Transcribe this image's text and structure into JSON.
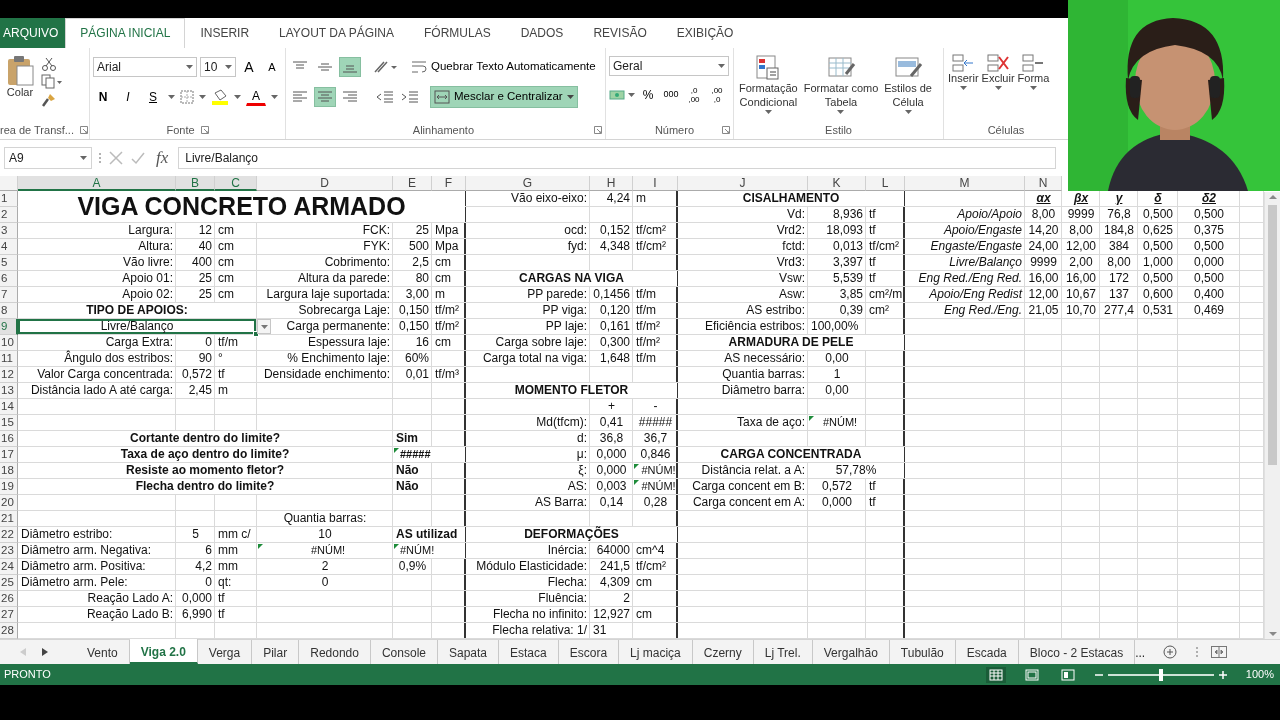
{
  "ribbon_tabs": [
    {
      "label": "ARQUIVO",
      "kind": "file",
      "selected": false
    },
    {
      "label": "PÁGINA INICIAL",
      "kind": "tab",
      "selected": true
    },
    {
      "label": "INSERIR",
      "kind": "tab",
      "selected": false
    },
    {
      "label": "LAYOUT DA PÁGINA",
      "kind": "tab",
      "selected": false
    },
    {
      "label": "FÓRMULAS",
      "kind": "tab",
      "selected": false
    },
    {
      "label": "DADOS",
      "kind": "tab",
      "selected": false
    },
    {
      "label": "REVISÃO",
      "kind": "tab",
      "selected": false
    },
    {
      "label": "EXIBIÇÃO",
      "kind": "tab",
      "selected": false
    }
  ],
  "clipboard": {
    "paste": "Colar",
    "label": "rea de Transf..."
  },
  "font": {
    "name": "Arial",
    "size": "10",
    "grow": "A",
    "shrink": "A",
    "bold": "N",
    "italic": "I",
    "underline": "S",
    "color_letter": "A",
    "label": "Fonte"
  },
  "alignment": {
    "vertical": [
      {
        "kind": "top",
        "selected": false
      },
      {
        "kind": "middle",
        "selected": false
      },
      {
        "kind": "bottom",
        "selected": true
      }
    ],
    "horizontal": [
      {
        "kind": "left",
        "selected": false
      },
      {
        "kind": "center",
        "selected": true
      },
      {
        "kind": "right",
        "selected": false
      }
    ],
    "wrap": "Quebrar Texto Automaticamente",
    "merge": {
      "label": "Mesclar e Centralizar",
      "selected": true
    },
    "label": "Alinhamento"
  },
  "number": {
    "format": "Geral",
    "percent": "%",
    "thousands": "000",
    "decimals": [
      {
        "top": ",0",
        "bottom": ",00"
      },
      {
        "top": ",00",
        "bottom": ",0"
      }
    ],
    "label": "Número"
  },
  "styles": {
    "buttons": [
      {
        "lines": [
          "Formatação",
          "Condicional"
        ],
        "kind": "conditional"
      },
      {
        "lines": [
          "Formatar como",
          "Tabela"
        ],
        "kind": "table"
      },
      {
        "lines": [
          "Estilos de",
          "Célula"
        ],
        "kind": "cellstyle"
      }
    ],
    "label": "Estilo"
  },
  "cells_group": {
    "buttons": [
      {
        "label": "Inserir",
        "kind": "insert"
      },
      {
        "label": "Excluir",
        "kind": "delete"
      },
      {
        "label": "Forma",
        "kind": "format"
      }
    ],
    "label": "Células"
  },
  "formula_bar": {
    "name_box": "A9",
    "fx": "fx",
    "content": "Livre/Balanço"
  },
  "columns": [
    {
      "label": "A",
      "selected": true
    },
    {
      "label": "B",
      "selected": true
    },
    {
      "label": "C",
      "selected": true
    },
    {
      "label": "D",
      "selected": false
    },
    {
      "label": "E",
      "selected": false
    },
    {
      "label": "F",
      "selected": false
    },
    {
      "label": "G",
      "selected": false
    },
    {
      "label": "H",
      "selected": false
    },
    {
      "label": "I",
      "selected": false
    },
    {
      "label": "J",
      "selected": false
    },
    {
      "label": "K",
      "selected": false
    },
    {
      "label": "L",
      "selected": false
    },
    {
      "label": "M",
      "selected": false
    },
    {
      "label": "N",
      "selected": false
    }
  ],
  "rows": [
    {
      "number": "1",
      "selected": false,
      "cells": [
        {
          "text": "VIGA CONCRETO ARMADO"
        },
        {
          "text": "Vão eixo-eixo:"
        },
        {
          "text": "4,24"
        },
        {
          "text": "m"
        },
        {
          "text": "CISALHAMENTO"
        },
        {
          "text": "αx"
        },
        {
          "text": "βx"
        },
        {
          "text": "γ"
        },
        {
          "text": "δ"
        },
        {
          "text": "δ2"
        }
      ]
    },
    {
      "number": "2",
      "selected": false,
      "cells": [
        {
          "text": "Vd:"
        },
        {
          "text": "8,936"
        },
        {
          "text": "tf"
        },
        {
          "text": "Apoio/Apoio"
        },
        {
          "text": "8,00"
        },
        {
          "text": "9999"
        },
        {
          "text": "76,8"
        },
        {
          "text": "0,500"
        },
        {
          "text": "0,500"
        }
      ]
    },
    {
      "number": "3",
      "selected": false,
      "cells": [
        {
          "text": "Largura:"
        },
        {
          "text": "12"
        },
        {
          "text": "cm"
        },
        {
          "text": "FCK:"
        },
        {
          "text": "25"
        },
        {
          "text": "Mpa"
        },
        {
          "text": "ocd:"
        },
        {
          "text": "0,152"
        },
        {
          "text": "tf/cm²"
        },
        {
          "text": "Vrd2:"
        },
        {
          "text": "18,093"
        },
        {
          "text": "tf"
        },
        {
          "text": "Apoio/Engaste"
        },
        {
          "text": "14,20"
        },
        {
          "text": "8,00"
        },
        {
          "text": "184,8"
        },
        {
          "text": "0,625"
        },
        {
          "text": "0,375"
        }
      ]
    },
    {
      "number": "4",
      "selected": false,
      "cells": [
        {
          "text": "Altura:"
        },
        {
          "text": "40"
        },
        {
          "text": "cm"
        },
        {
          "text": "FYK:"
        },
        {
          "text": "500"
        },
        {
          "text": "Mpa"
        },
        {
          "text": "fyd:"
        },
        {
          "text": "4,348"
        },
        {
          "text": "tf/cm²"
        },
        {
          "text": "fctd:"
        },
        {
          "text": "0,013"
        },
        {
          "text": "tf/cm²"
        },
        {
          "text": "Engaste/Engaste"
        },
        {
          "text": "24,00"
        },
        {
          "text": "12,00"
        },
        {
          "text": "384"
        },
        {
          "text": "0,500"
        },
        {
          "text": "0,500"
        }
      ]
    },
    {
      "number": "5",
      "selected": false,
      "cells": [
        {
          "text": "Vão livre:"
        },
        {
          "text": "400"
        },
        {
          "text": "cm"
        },
        {
          "text": "Cobrimento:"
        },
        {
          "text": "2,5"
        },
        {
          "text": "cm"
        },
        {
          "text": "Vrd3:"
        },
        {
          "text": "3,397"
        },
        {
          "text": "tf"
        },
        {
          "text": "Livre/Balanço"
        },
        {
          "text": "9999"
        },
        {
          "text": "2,00"
        },
        {
          "text": "8,00"
        },
        {
          "text": "1,000"
        },
        {
          "text": "0,000"
        }
      ]
    },
    {
      "number": "6",
      "selected": false,
      "cells": [
        {
          "text": "Apoio 01:"
        },
        {
          "text": "25"
        },
        {
          "text": "cm"
        },
        {
          "text": "Altura da parede:"
        },
        {
          "text": "80"
        },
        {
          "text": "cm"
        },
        {
          "text": "CARGAS NA VIGA"
        },
        {
          "text": "Vsw:"
        },
        {
          "text": "5,539"
        },
        {
          "text": "tf"
        },
        {
          "text": "Eng Red./Eng Red."
        },
        {
          "text": "16,00"
        },
        {
          "text": "16,00"
        },
        {
          "text": "172"
        },
        {
          "text": "0,500"
        },
        {
          "text": "0,500"
        }
      ]
    },
    {
      "number": "7",
      "selected": false,
      "cells": [
        {
          "text": "Apoio 02:"
        },
        {
          "text": "25"
        },
        {
          "text": "cm"
        },
        {
          "text": "Largura laje suportada:"
        },
        {
          "text": "3,00"
        },
        {
          "text": "m"
        },
        {
          "text": "PP parede:"
        },
        {
          "text": "0,1456"
        },
        {
          "text": "tf/m"
        },
        {
          "text": "Asw:"
        },
        {
          "text": "3,85"
        },
        {
          "text": "cm²/m"
        },
        {
          "text": "Apoio/Eng Redist"
        },
        {
          "text": "12,00"
        },
        {
          "text": "10,67"
        },
        {
          "text": "137"
        },
        {
          "text": "0,600"
        },
        {
          "text": "0,400"
        }
      ]
    },
    {
      "number": "8",
      "selected": false,
      "cells": [
        {
          "text": "TIPO DE APOIOS:"
        },
        {
          "text": "Sobrecarga Laje:"
        },
        {
          "text": "0,150"
        },
        {
          "text": "tf/m²"
        },
        {
          "text": "PP viga:"
        },
        {
          "text": "0,120"
        },
        {
          "text": "tf/m"
        },
        {
          "text": "AS estribo:"
        },
        {
          "text": "0,39"
        },
        {
          "text": "cm²"
        },
        {
          "text": "Eng Red./Eng."
        },
        {
          "text": "21,05"
        },
        {
          "text": "10,70"
        },
        {
          "text": "277,4"
        },
        {
          "text": "0,531"
        },
        {
          "text": "0,469"
        }
      ]
    },
    {
      "number": "9",
      "selected": true,
      "cells": [
        {
          "text": "Livre/Balanço",
          "selected": true
        },
        {
          "text": "Carga permanente:"
        },
        {
          "text": "0,150"
        },
        {
          "text": "tf/m²"
        },
        {
          "text": "PP laje:"
        },
        {
          "text": "0,161"
        },
        {
          "text": "tf/m²"
        },
        {
          "text": "Eficiência estribos:"
        },
        {
          "text": "100,00%"
        }
      ]
    },
    {
      "number": "10",
      "selected": false,
      "cells": [
        {
          "text": "Carga Extra:"
        },
        {
          "text": "0"
        },
        {
          "text": "tf/m"
        },
        {
          "text": "Espessura laje:"
        },
        {
          "text": "16"
        },
        {
          "text": "cm"
        },
        {
          "text": "Carga sobre laje:"
        },
        {
          "text": "0,300"
        },
        {
          "text": "tf/m²"
        },
        {
          "text": "ARMADURA DE PELE"
        }
      ]
    },
    {
      "number": "11",
      "selected": false,
      "cells": [
        {
          "text": "Ângulo dos estribos:"
        },
        {
          "text": "90"
        },
        {
          "text": "°"
        },
        {
          "text": "% Enchimento laje:"
        },
        {
          "text": "60%"
        },
        {
          "text": "Carga total na viga:"
        },
        {
          "text": "1,648"
        },
        {
          "text": "tf/m"
        },
        {
          "text": "AS necessário:"
        },
        {
          "text": "0,00"
        }
      ]
    },
    {
      "number": "12",
      "selected": false,
      "cells": [
        {
          "text": "Valor Carga concentrada:"
        },
        {
          "text": "0,572"
        },
        {
          "text": "tf"
        },
        {
          "text": "Densidade enchimento:"
        },
        {
          "text": "0,01"
        },
        {
          "text": "tf/m³"
        },
        {
          "text": "Quantia barras:"
        },
        {
          "text": "1"
        }
      ]
    },
    {
      "number": "13",
      "selected": false,
      "cells": [
        {
          "text": "Distância lado A até carga:"
        },
        {
          "text": "2,45"
        },
        {
          "text": "m"
        },
        {
          "text": "MOMENTO FLETOR"
        },
        {
          "text": "Diâmetro barra:"
        },
        {
          "text": "0,00"
        }
      ]
    },
    {
      "number": "14",
      "selected": false,
      "cells": [
        {
          "text": "+"
        },
        {
          "text": "-"
        }
      ]
    },
    {
      "number": "15",
      "selected": false,
      "cells": [
        {
          "text": "Md(tfcm):"
        },
        {
          "text": "0,41"
        },
        {
          "text": "#####"
        },
        {
          "text": "Taxa de aço:"
        },
        {
          "text": "#NÚM!",
          "warning": true
        }
      ]
    },
    {
      "number": "16",
      "selected": false,
      "cells": [
        {
          "text": "Cortante dentro do limite?"
        },
        {
          "text": "Sim"
        },
        {
          "text": "d:"
        },
        {
          "text": "36,8"
        },
        {
          "text": "36,7"
        }
      ]
    },
    {
      "number": "17",
      "selected": false,
      "cells": [
        {
          "text": "Taxa de aço dentro do limite?"
        },
        {
          "text": "#####",
          "warning": true
        },
        {
          "text": "μ:"
        },
        {
          "text": "0,000"
        },
        {
          "text": "0,846"
        },
        {
          "text": "CARGA CONCENTRADA"
        }
      ]
    },
    {
      "number": "18",
      "selected": false,
      "cells": [
        {
          "text": "Resiste ao momento fletor?"
        },
        {
          "text": "Não"
        },
        {
          "text": "ξ:"
        },
        {
          "text": "0,000"
        },
        {
          "text": "#NÚM!",
          "warning": true
        },
        {
          "text": "Distância relat. a A:"
        },
        {
          "text": "57,78%"
        }
      ]
    },
    {
      "number": "19",
      "selected": false,
      "cells": [
        {
          "text": "Flecha dentro do limite?"
        },
        {
          "text": "Não"
        },
        {
          "text": "AS:"
        },
        {
          "text": "0,003"
        },
        {
          "text": "#NÚM!",
          "warning": true
        },
        {
          "text": "Carga concent em B:"
        },
        {
          "text": "0,572"
        },
        {
          "text": "tf"
        }
      ]
    },
    {
      "number": "20",
      "selected": false,
      "cells": [
        {
          "text": "AS Barra:"
        },
        {
          "text": "0,14"
        },
        {
          "text": "0,28"
        },
        {
          "text": "Carga concent em A:"
        },
        {
          "text": "0,000"
        },
        {
          "text": "tf"
        }
      ]
    },
    {
      "number": "21",
      "selected": false,
      "cells": [
        {
          "text": "Quantia barras:"
        }
      ]
    },
    {
      "number": "22",
      "selected": false,
      "cells": [
        {
          "text": "Diâmetro estribo:"
        },
        {
          "text": "5"
        },
        {
          "text": "mm c/"
        },
        {
          "text": "10"
        },
        {
          "text": "AS utilizad"
        },
        {
          "text": "DEFORMAÇÕES"
        }
      ]
    },
    {
      "number": "23",
      "selected": false,
      "cells": [
        {
          "text": "Diâmetro arm. Negativa:"
        },
        {
          "text": "6"
        },
        {
          "text": "mm"
        },
        {
          "text": "#NÚM!",
          "warning": true
        },
        {
          "text": "#NÚM!",
          "warning": true
        },
        {
          "text": "Inércia:"
        },
        {
          "text": "64000"
        },
        {
          "text": "cm^4"
        }
      ]
    },
    {
      "number": "24",
      "selected": false,
      "cells": [
        {
          "text": "Diâmetro arm. Positiva:"
        },
        {
          "text": "4,2"
        },
        {
          "text": "mm"
        },
        {
          "text": "2"
        },
        {
          "text": "0,9%"
        },
        {
          "text": "Módulo Elasticidade:"
        },
        {
          "text": "241,5"
        },
        {
          "text": "tf/cm²"
        }
      ]
    },
    {
      "number": "25",
      "selected": false,
      "cells": [
        {
          "text": "Diâmetro arm. Pele:"
        },
        {
          "text": "0"
        },
        {
          "text": "qt:"
        },
        {
          "text": "0"
        },
        {
          "text": "Flecha:"
        },
        {
          "text": "4,309"
        },
        {
          "text": "cm"
        }
      ]
    },
    {
      "number": "26",
      "selected": false,
      "cells": [
        {
          "text": "Reação Lado A:"
        },
        {
          "text": "0,000"
        },
        {
          "text": "tf"
        },
        {
          "text": "Fluência:"
        },
        {
          "text": "2"
        }
      ]
    },
    {
      "number": "27",
      "selected": false,
      "cells": [
        {
          "text": "Reação Lado B:"
        },
        {
          "text": "6,990"
        },
        {
          "text": "tf"
        },
        {
          "text": "Flecha no infinito:"
        },
        {
          "text": "12,927"
        },
        {
          "text": "cm"
        }
      ]
    },
    {
      "number": "28",
      "selected": false,
      "cells": [
        {
          "text": "Flecha relativa: 1/"
        },
        {
          "text": "31"
        }
      ]
    }
  ],
  "sheet_tabs": [
    {
      "label": "Vento",
      "selected": false
    },
    {
      "label": "Viga 2.0",
      "selected": true
    },
    {
      "label": "Verga",
      "selected": false
    },
    {
      "label": "Pilar",
      "selected": false
    },
    {
      "label": "Redondo",
      "selected": false
    },
    {
      "label": "Console",
      "selected": false
    },
    {
      "label": "Sapata",
      "selected": false
    },
    {
      "label": "Estaca",
      "selected": false
    },
    {
      "label": "Escora",
      "selected": false
    },
    {
      "label": "Lj maciça",
      "selected": false
    },
    {
      "label": "Czerny",
      "selected": false
    },
    {
      "label": "Lj Trel.",
      "selected": false
    },
    {
      "label": "Vergalhão",
      "selected": false
    },
    {
      "label": "Tubulão",
      "selected": false
    },
    {
      "label": "Escada",
      "selected": false
    },
    {
      "label": "Bloco - 2 Estacas",
      "selected": false
    }
  ],
  "more_tabs": "...",
  "status": "PRONTO",
  "views": [
    {
      "kind": "normal",
      "selected": true
    },
    {
      "kind": "layout",
      "selected": false
    },
    {
      "kind": "pagebreak",
      "selected": false
    }
  ],
  "zoom": {
    "level": 0.5,
    "reading": "100%"
  }
}
